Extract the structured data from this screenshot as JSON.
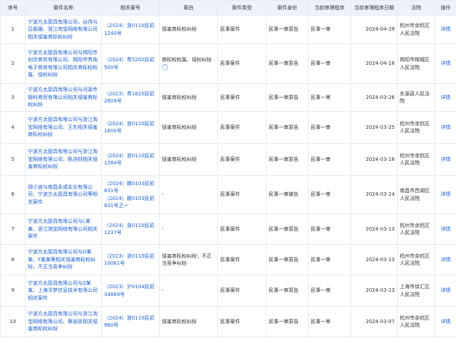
{
  "headers": [
    "序号",
    "案件名称",
    "相关案号",
    "案由",
    "案件类型",
    "案件身份",
    "当前审理程序",
    "当前审理程序日期",
    "法院",
    "操作"
  ],
  "rows": [
    {
      "no": "1",
      "name": "宁波方太厨具有限公司，谷伟与吕振珊、浙江淘宝网络有限公司相关侵害商标权纠纷",
      "case_nos": [
        "（2024）浙0110民初1240号"
      ],
      "cause": "侵害商标权纠纷",
      "cause_help": false,
      "type": "民事案件",
      "role": "民事一审原告",
      "stage": "民事一审",
      "date": "2024-04-29",
      "court": "杭州市余杭区人民法院",
      "op": "详情"
    },
    {
      "no": "2",
      "name": "宁波方太厨具有限公司与揭阳市创信商贸有限公司、揭阳市秀逸电子商务有限公司相关商标权权属、侵权纠纷",
      "case_nos": [
        "（2024）粤5202民初500号"
      ],
      "cause": "商标权权属、侵权纠纷",
      "cause_help": true,
      "type": "民事案件",
      "role": "民事一审原告",
      "stage": "民事一审",
      "date": "2024-04-18",
      "court": "揭阳市榕城区人民法院",
      "op": "详情"
    },
    {
      "no": "3",
      "name": "宁波方太厨具有限公司与河源市锦科商贸有限公司相关侵害商标权纠纷",
      "case_nos": [
        "（2023）粤1625民初2809号"
      ],
      "cause": "侵害商标权纠纷",
      "cause_help": false,
      "type": "民事案件",
      "role": "民事一审原告",
      "stage": "民事一审",
      "date": "2024-03-26",
      "court": "东源县人民法院",
      "op": "详情"
    },
    {
      "no": "4",
      "name": "宁波方太厨具有限公司与浙江淘宝网络有限公司、王东相关侵害商标权纠纷",
      "case_nos": [
        "（2024）浙0110民初1600号"
      ],
      "cause": "侵害商标权纠纷",
      "cause_help": false,
      "type": "民事案件",
      "role": "民事一审原告",
      "stage": "民事一审",
      "date": "2024-03-25",
      "court": "杭州市余杭区人民法院",
      "op": "详情"
    },
    {
      "no": "5",
      "name": "宁波方太厨具有限公司与浙江淘宝网络有限公司、陈进财相关侵害商标权纠纷",
      "case_nos": [
        "（2024）浙0110民初1284号"
      ],
      "cause": "侵害商标权纠纷",
      "cause_help": false,
      "type": "民事案件",
      "role": "民事一审原告",
      "stage": "民事一审",
      "date": "2024-03-18",
      "court": "杭州市余杭区人民法院",
      "op": "详情"
    },
    {
      "no": "6",
      "name": "胡小波与南昌永成实业有限公司、宁波方太厨具有限公司等相关案件",
      "case_nos": [
        "（2024）赣0103民初831号",
        "（2024）赣0103民初831号之一"
      ],
      "cause": "-",
      "cause_help": false,
      "type": "民事案件",
      "role": "民事一审被告",
      "stage": "民事一审",
      "date": "2024-03-14",
      "court": "南昌市西湖区人民法院",
      "op": "详情"
    },
    {
      "no": "7",
      "name": "宁波方太厨具有限公司与L某某、浙江淘宝网络有限公司相关案件",
      "case_nos": [
        "（2024）浙0110民初1237号"
      ],
      "cause": "-",
      "cause_help": false,
      "type": "民事案件",
      "role": "民事一审原告",
      "stage": "民事一审",
      "date": "2024-03-13",
      "court": "杭州市余杭区人民法院",
      "op": "详情"
    },
    {
      "no": "8",
      "name": "宁波方太厨具有限公司与D某某、F某某等相关侵害商标权纠纷，不正当竞争纠纷",
      "case_nos": [
        "（2023）浙0110民初10061号"
      ],
      "cause": "侵害商标权纠纷；不正当竞争纠纷",
      "cause_help": false,
      "type": "民事案件",
      "role": "民事一审原告",
      "stage": "民事一审",
      "date": "2024-03-13",
      "court": "杭州市余杭区人民法院",
      "op": "详情"
    },
    {
      "no": "9",
      "name": "宁波方太厨具有限公司与Z某某、上海寻梦信息技术有限公司相关案件",
      "case_nos": [
        "（2023）沪0104民初34889号"
      ],
      "cause": "-",
      "cause_help": false,
      "type": "民事案件",
      "role": "民事一审原告",
      "stage": "民事一审",
      "date": "2024-03-13",
      "court": "上海市徐汇区人民法院",
      "op": "详情"
    },
    {
      "no": "10",
      "name": "宁波方太厨具有限公司与浙江淘宝网络有限公司、蔡丽玫相关侵害商标权纠纷",
      "case_nos": [
        "（2024）浙0110民初960号"
      ],
      "cause": "侵害商标权纠纷",
      "cause_help": false,
      "type": "民事案件",
      "role": "民事一审原告",
      "stage": "民事一审",
      "date": "2024-03-07",
      "court": "杭州市余杭区人民法院",
      "op": "详情"
    }
  ]
}
